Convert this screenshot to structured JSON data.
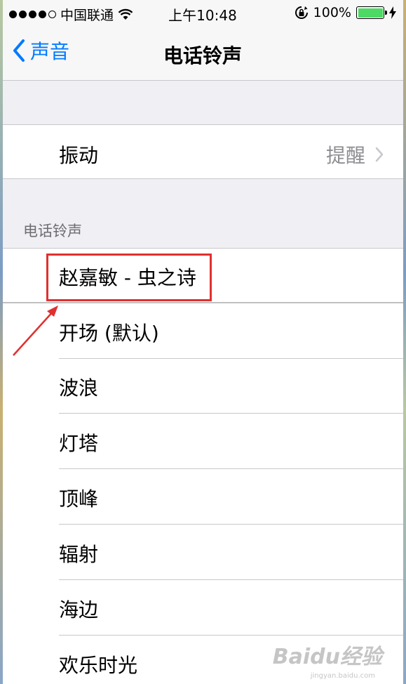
{
  "status_bar": {
    "carrier": "中国联通",
    "time": "上午10:48",
    "battery_percent": "100%",
    "battery_level": 1.0,
    "battery_color": "#4cd964"
  },
  "nav": {
    "back_label": "声音",
    "title": "电话铃声",
    "accent_color": "#007aff"
  },
  "vibration": {
    "label": "振动",
    "value": "提醒"
  },
  "ringtones": {
    "header": "电话铃声",
    "items": [
      {
        "label": "赵嘉敏 - 虫之诗"
      },
      {
        "label": "开场 (默认)"
      },
      {
        "label": "波浪"
      },
      {
        "label": "灯塔"
      },
      {
        "label": "顶峰"
      },
      {
        "label": "辐射"
      },
      {
        "label": "海边"
      },
      {
        "label": "欢乐时光"
      }
    ]
  },
  "annotation": {
    "color": "#e03030"
  },
  "watermark": {
    "text": "Baidu经验",
    "sub": "jingyan.baidu.com"
  }
}
